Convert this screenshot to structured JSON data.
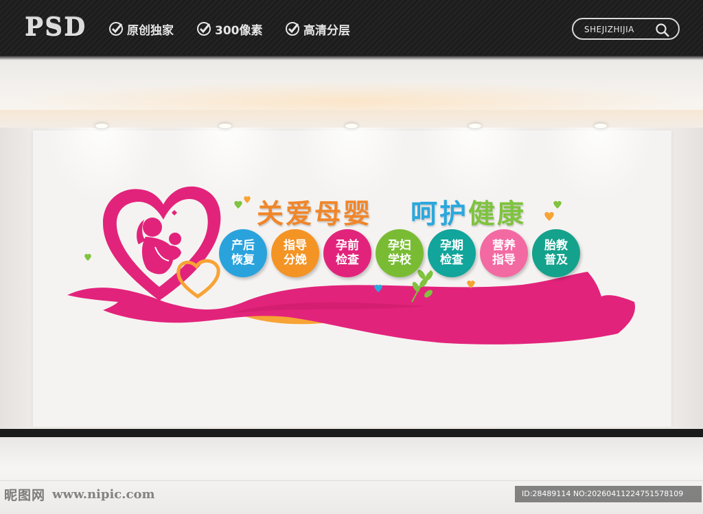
{
  "header": {
    "logo": "PSD",
    "badges": [
      "原创独家",
      "300像素",
      "高清分层"
    ],
    "search_label": "SHEJIZHIJIA"
  },
  "artwork": {
    "title_left": "关爱母婴",
    "title_right_a": "呵护",
    "title_right_b": "健康",
    "circles": [
      {
        "line1": "产后",
        "line2": "恢复",
        "color": "#2aa3dd"
      },
      {
        "line1": "指导",
        "line2": "分娩",
        "color": "#f39425"
      },
      {
        "line1": "孕前",
        "line2": "检查",
        "color": "#e2237b"
      },
      {
        "line1": "孕妇",
        "line2": "学校",
        "color": "#79bc34"
      },
      {
        "line1": "孕期",
        "line2": "检查",
        "color": "#11a59b"
      },
      {
        "line1": "营养",
        "line2": "指导",
        "color": "#f36aa3"
      },
      {
        "line1": "胎教",
        "line2": "普及",
        "color": "#14a28c"
      }
    ],
    "colors": {
      "magenta": "#e2237b",
      "orange": "#f7a335",
      "green": "#7fc33f",
      "blue": "#2aa8de"
    }
  },
  "watermark": {
    "site_logo": "昵图网",
    "url": "www.nipic.com",
    "id_text": "ID:28489114 NO:20260411224751578109"
  }
}
